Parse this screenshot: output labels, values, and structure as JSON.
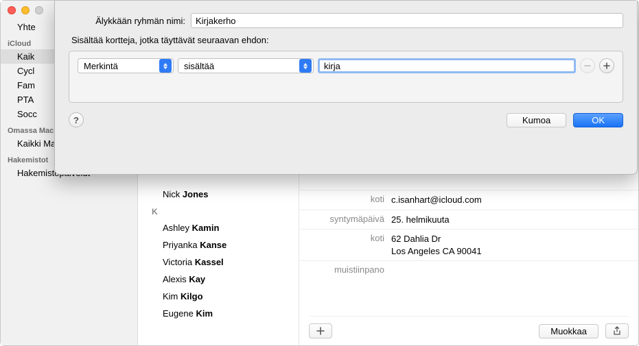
{
  "sidebar": {
    "items": [
      {
        "label": "Yhte"
      },
      {
        "section": "iCloud"
      },
      {
        "label": "Kaik",
        "selected": true
      },
      {
        "label": "Cycl"
      },
      {
        "label": "Fam"
      },
      {
        "label": "PTA"
      },
      {
        "label": "Socc"
      },
      {
        "section": "Omassa Macissa"
      },
      {
        "label": "Kaikki Macissa"
      },
      {
        "section": "Hakemistot"
      },
      {
        "label": "Hakemistopalvelut"
      }
    ]
  },
  "list": {
    "featured": {
      "first": "Nick",
      "last": "Jones"
    },
    "letter": "K",
    "rows": [
      {
        "first": "Ashley",
        "last": "Kamin"
      },
      {
        "first": "Priyanka",
        "last": "Kanse"
      },
      {
        "first": "Victoria",
        "last": "Kassel"
      },
      {
        "first": "Alexis",
        "last": "Kay"
      },
      {
        "first": "Kim",
        "last": "Kilgo"
      },
      {
        "first": "Eugene",
        "last": "Kim"
      }
    ]
  },
  "detail": {
    "rows": [
      {
        "label": "koti",
        "value": "c.isanhart@icloud.com"
      },
      {
        "label": "syntymäpäivä",
        "value": "25. helmikuuta"
      },
      {
        "label": "koti",
        "value": "62 Dahlia Dr\nLos Angeles CA 90041"
      },
      {
        "label": "muistiinpano",
        "value": ""
      }
    ],
    "edit_label": "Muokkaa"
  },
  "sheet": {
    "name_label": "Älykkään ryhmän nimi:",
    "name_value": "Kirjakerho",
    "subtitle": "Sisältää kortteja, jotka täyttävät seuraavan ehdon:",
    "rule": {
      "field": "Merkintä",
      "op": "sisältää",
      "value": "kirja"
    },
    "cancel": "Kumoa",
    "ok": "OK"
  }
}
